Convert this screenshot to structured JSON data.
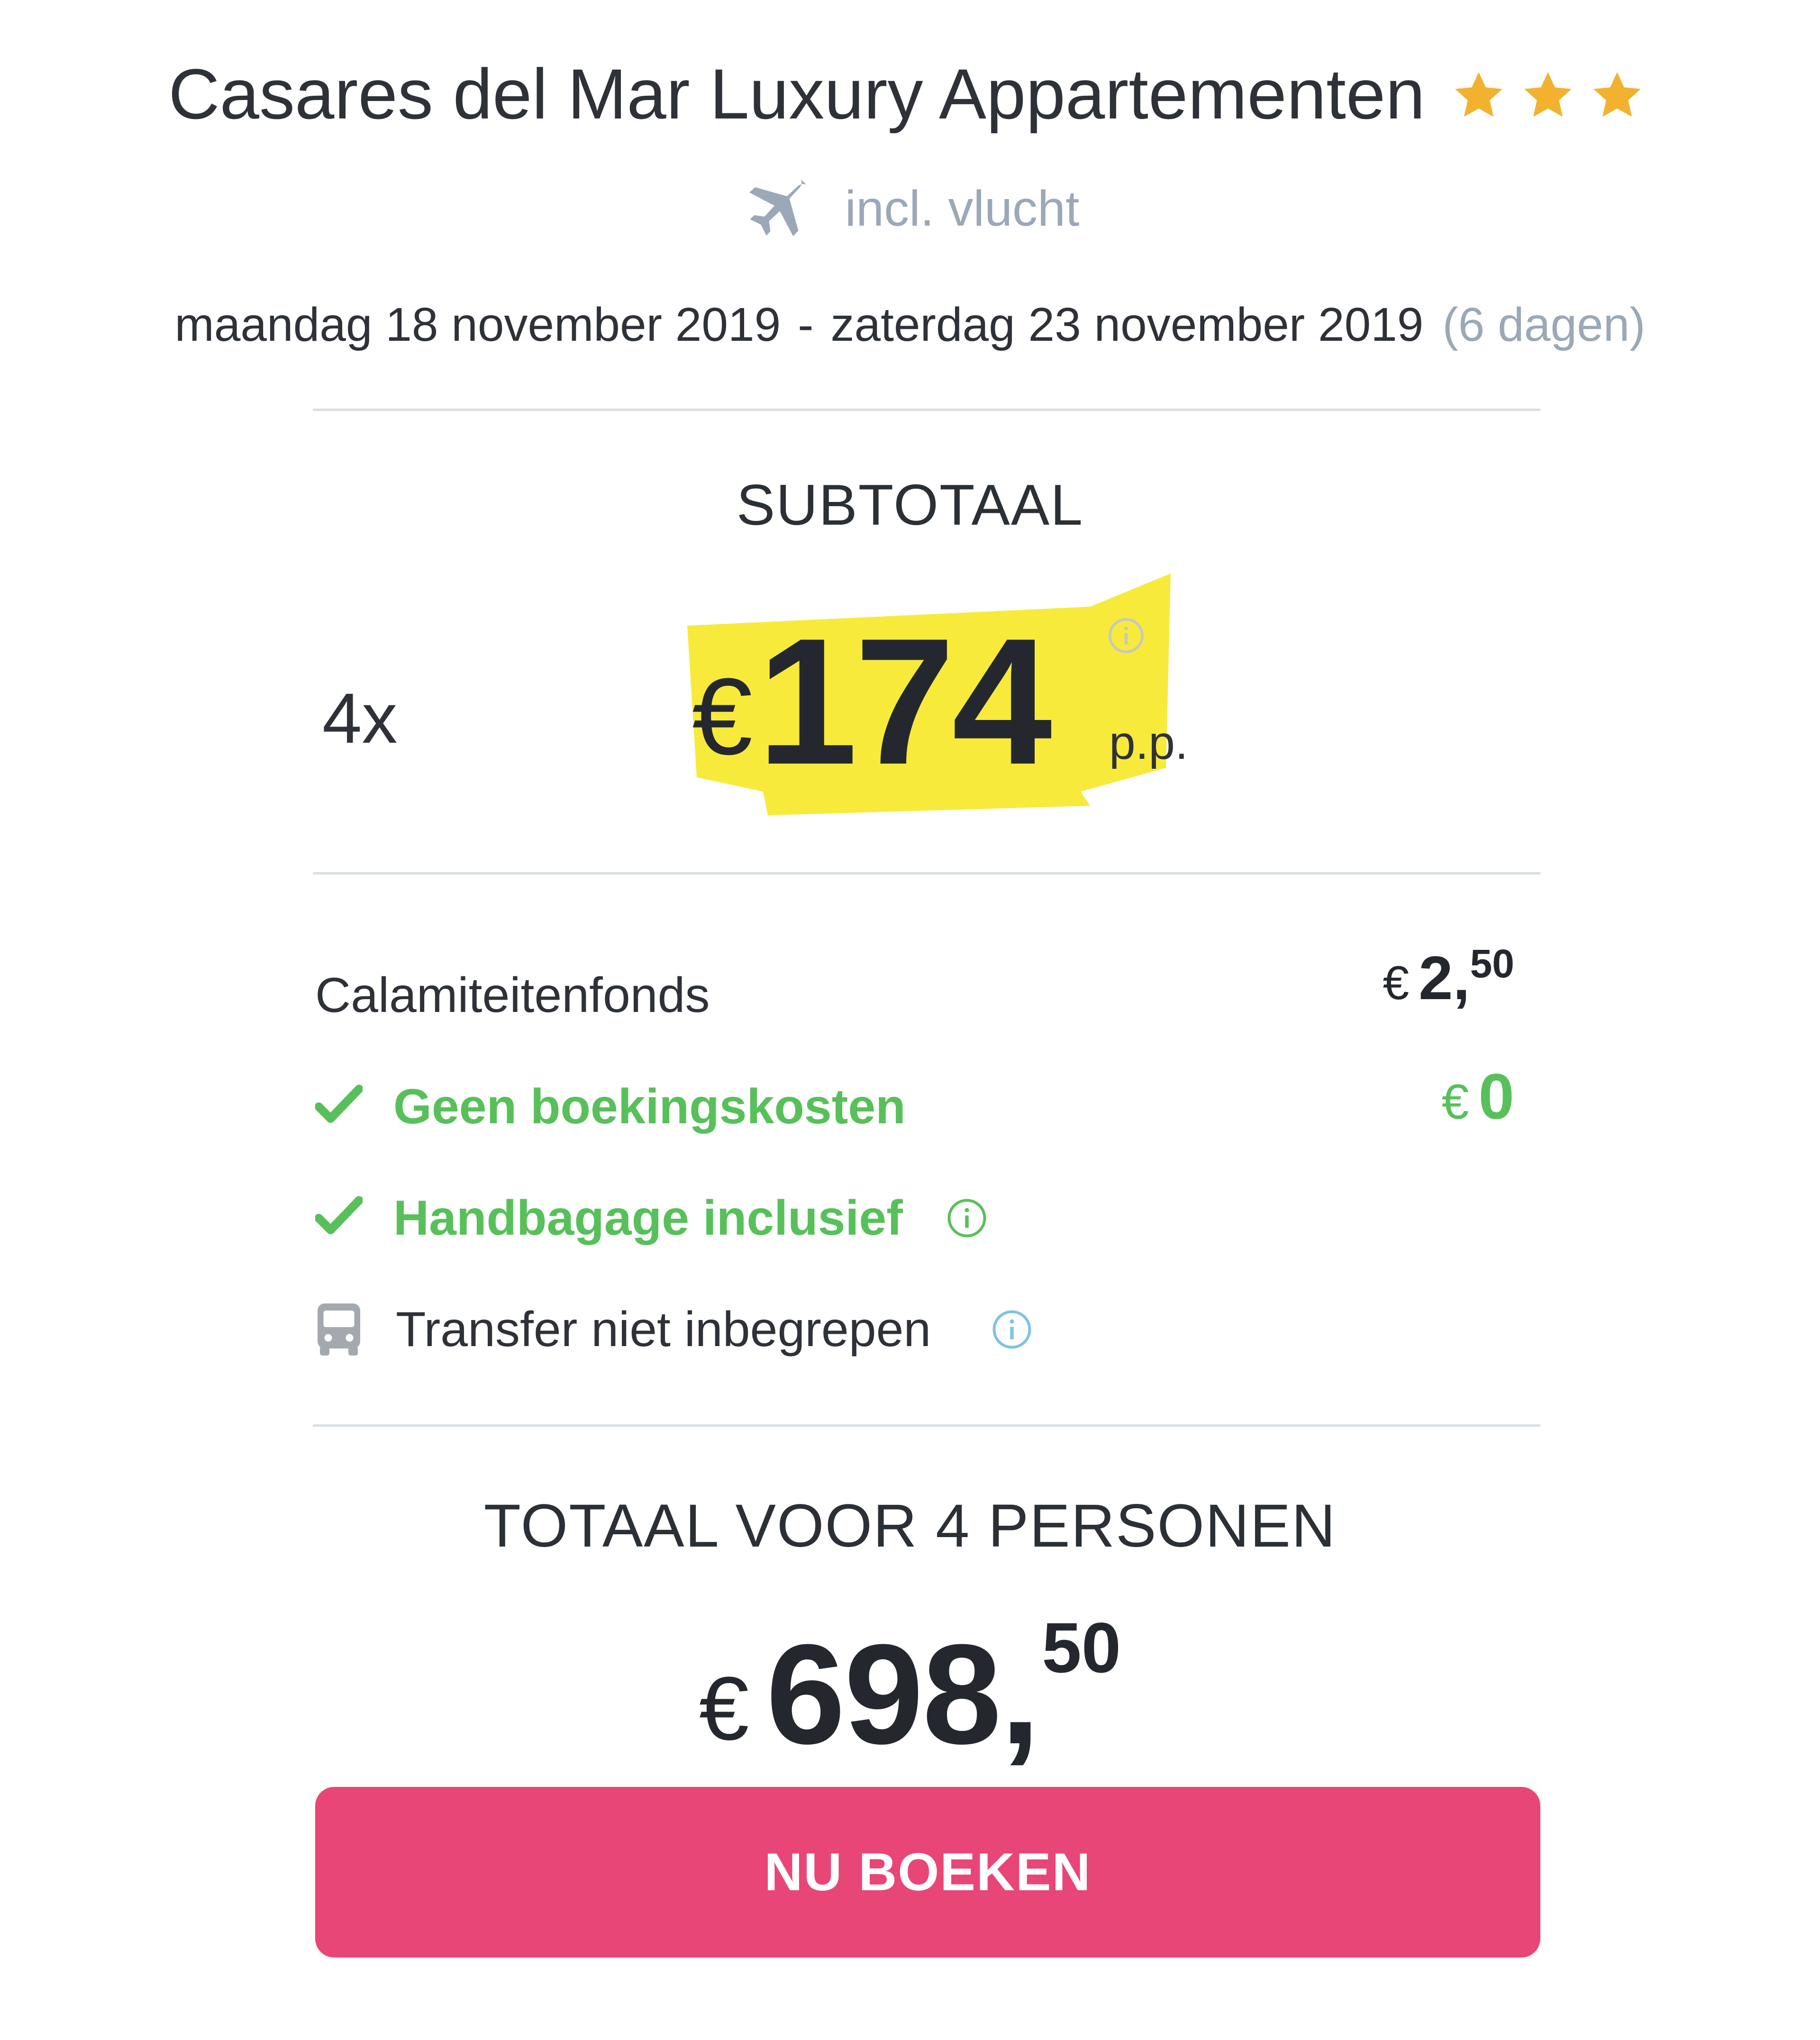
{
  "hotel": {
    "name": "Casares del Mar Luxury Appartementen",
    "star_rating": 3,
    "star_color": "#f2b22f"
  },
  "flight": {
    "icon": "plane-icon",
    "label": "incl. vlucht"
  },
  "dates": {
    "start": "maandag 18 november 2019",
    "separator": "-",
    "end": "zaterdag 23 november 2019",
    "duration": "(6 dagen)"
  },
  "subtotal": {
    "heading": "SUBTOTAAL",
    "quantity": "4x",
    "currency": "€",
    "amount": "174",
    "per_person": "p.p.",
    "highlight_color": "#f7ea3b"
  },
  "fees": {
    "calamity_fund": {
      "label": "Calamiteitenfonds",
      "currency": "€",
      "amount": "2,",
      "cents": "50"
    },
    "booking_costs": {
      "icon": "check-icon",
      "label": "Geen boekingskosten",
      "currency": "€",
      "amount": "0"
    },
    "hand_luggage": {
      "icon": "check-icon",
      "label": "Handbagage inclusief",
      "info_icon": "info-icon"
    },
    "transfer": {
      "icon": "bus-icon",
      "label": "Transfer niet inbegrepen",
      "info_icon": "info-icon"
    }
  },
  "total": {
    "heading": "TOTAAL VOOR 4 PERSONEN",
    "currency": "€",
    "amount": "698,",
    "cents": "50"
  },
  "cta": {
    "label": "NU BOEKEN",
    "color": "#e84677"
  },
  "colors": {
    "green": "#58c05a",
    "muted": "#9aa8b8",
    "info_blue": "#7ec3e6"
  }
}
